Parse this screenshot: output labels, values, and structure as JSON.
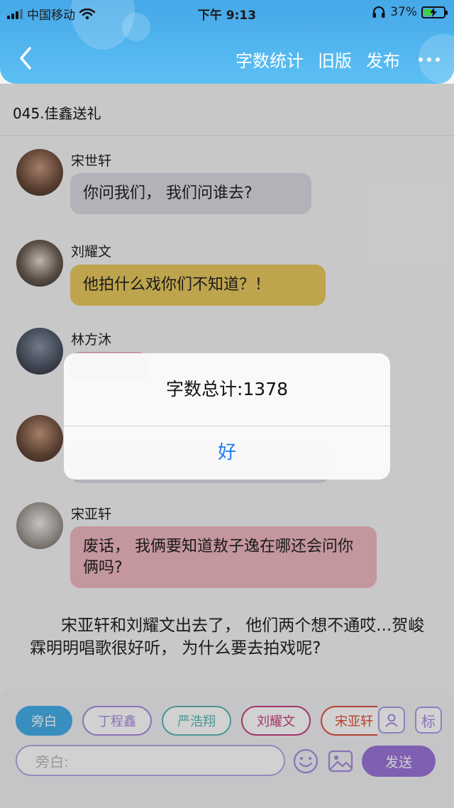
{
  "status_bar": {
    "carrier": "中国移动",
    "time": "下午 9:13",
    "battery_percent": "37%",
    "battery_level": 0.37
  },
  "nav": {
    "word_count": "字数统计",
    "old_version": "旧版",
    "publish": "发布"
  },
  "chapter_title": "045.佳鑫送礼",
  "messages": [
    {
      "name": "宋世轩",
      "text": "你问我们， 我们问谁去?",
      "bubble_color": "#d9dbe2"
    },
    {
      "name": "刘耀文",
      "text": "他拍什么戏你们不知道？！",
      "bubble_color": "#e8c85e"
    },
    {
      "name": "林方沐",
      "text": "",
      "bubble_color": "#f0b7c0"
    },
    {
      "name": "",
      "text": "",
      "bubble_color": "#d9dbe2"
    },
    {
      "name": "宋亚轩",
      "text": "废话， 我俩要知道敖子逸在哪还会问你俩吗?",
      "bubble_color": "#f0b7c0"
    }
  ],
  "narration": "宋亚轩和刘耀文出去了， 他们两个想不通哎...贺峻霖明明唱歌很好听， 为什么要去拍戏呢?",
  "alert": {
    "message": "字数总计:1378",
    "ok": "好"
  },
  "roles": [
    {
      "label": "旁白",
      "color": "#45aee8",
      "active": true
    },
    {
      "label": "丁程鑫",
      "color": "#a98be0",
      "active": false
    },
    {
      "label": "严浩翔",
      "color": "#5ab7b5",
      "active": false
    },
    {
      "label": "刘耀文",
      "color": "#c8417e",
      "active": false
    },
    {
      "label": "宋亚轩",
      "color": "#e0513e",
      "active": false
    }
  ],
  "side_buttons": {
    "tag": "标"
  },
  "composer": {
    "placeholder": "旁白:",
    "send": "发送"
  },
  "colors": {
    "header_blue": "#4fb2ee",
    "accent_purple": "#9b74d8",
    "ios_blue": "#1f7bf0"
  }
}
